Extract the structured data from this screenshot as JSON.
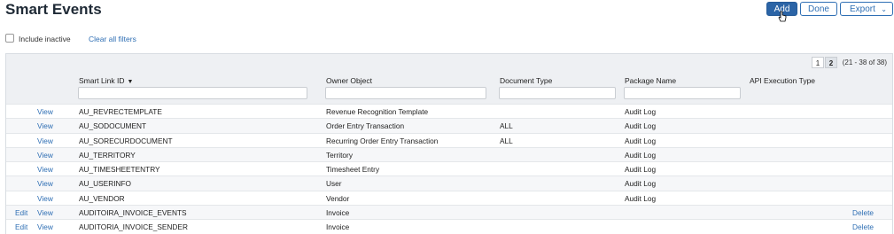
{
  "header": {
    "title": "Smart Events",
    "add_label": "Add",
    "done_label": "Done",
    "export_label": "Export"
  },
  "filters": {
    "include_inactive_label": "Include inactive",
    "clear_all_label": "Clear all filters"
  },
  "pager": {
    "pages": [
      "1",
      "2"
    ],
    "range_text": "(21 - 38 of 38)"
  },
  "columns": {
    "smart_link_id": "Smart Link ID",
    "owner_object": "Owner Object",
    "document_type": "Document Type",
    "package_name": "Package Name",
    "api_execution_type": "API Execution Type"
  },
  "rows": [
    {
      "edit": "",
      "view": "View",
      "id": "AU_REVRECTEMPLATE",
      "owner": "Revenue Recognition Template",
      "doctype": "",
      "package": "Audit Log",
      "delete": ""
    },
    {
      "edit": "",
      "view": "View",
      "id": "AU_SODOCUMENT",
      "owner": "Order Entry Transaction",
      "doctype": "ALL",
      "package": "Audit Log",
      "delete": ""
    },
    {
      "edit": "",
      "view": "View",
      "id": "AU_SORECURDOCUMENT",
      "owner": "Recurring Order Entry Transaction",
      "doctype": "ALL",
      "package": "Audit Log",
      "delete": ""
    },
    {
      "edit": "",
      "view": "View",
      "id": "AU_TERRITORY",
      "owner": "Territory",
      "doctype": "",
      "package": "Audit Log",
      "delete": ""
    },
    {
      "edit": "",
      "view": "View",
      "id": "AU_TIMESHEETENTRY",
      "owner": "Timesheet Entry",
      "doctype": "",
      "package": "Audit Log",
      "delete": ""
    },
    {
      "edit": "",
      "view": "View",
      "id": "AU_USERINFO",
      "owner": "User",
      "doctype": "",
      "package": "Audit Log",
      "delete": ""
    },
    {
      "edit": "",
      "view": "View",
      "id": "AU_VENDOR",
      "owner": "Vendor",
      "doctype": "",
      "package": "Audit Log",
      "delete": ""
    },
    {
      "edit": "Edit",
      "view": "View",
      "id": "AUDITOIRA_INVOICE_EVENTS",
      "owner": "Invoice",
      "doctype": "",
      "package": "",
      "delete": "Delete"
    },
    {
      "edit": "Edit",
      "view": "View",
      "id": "AUDITORIA_INVOICE_SENDER",
      "owner": "Invoice",
      "doctype": "",
      "package": "",
      "delete": "Delete"
    }
  ]
}
